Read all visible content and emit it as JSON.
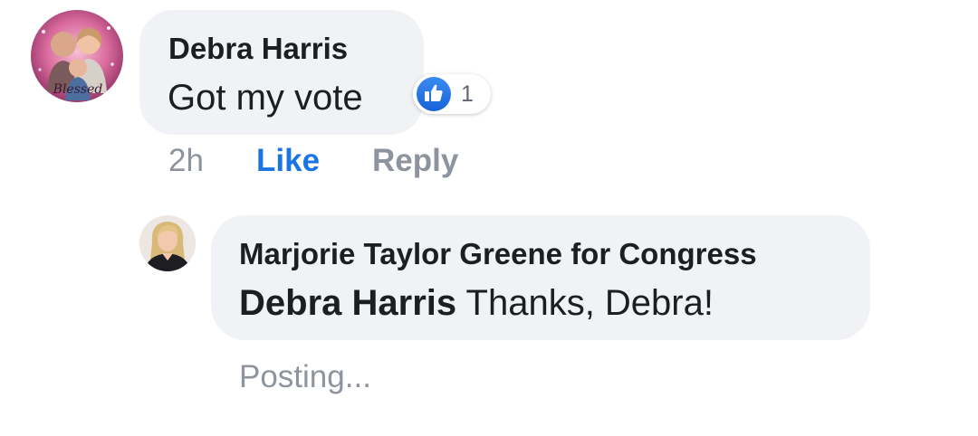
{
  "comment": {
    "author": "Debra Harris",
    "text": "Got my vote",
    "avatar_caption": "Blessed",
    "reaction": {
      "icon": "thumbs-up-icon",
      "count": "1",
      "color": "#1b74e4"
    },
    "timestamp": "2h",
    "like_label": "Like",
    "reply_label": "Reply"
  },
  "reply": {
    "author": "Marjorie Taylor Greene for Congress",
    "mention": "Debra Harris",
    "text": " Thanks, Debra!",
    "status": "Posting..."
  }
}
